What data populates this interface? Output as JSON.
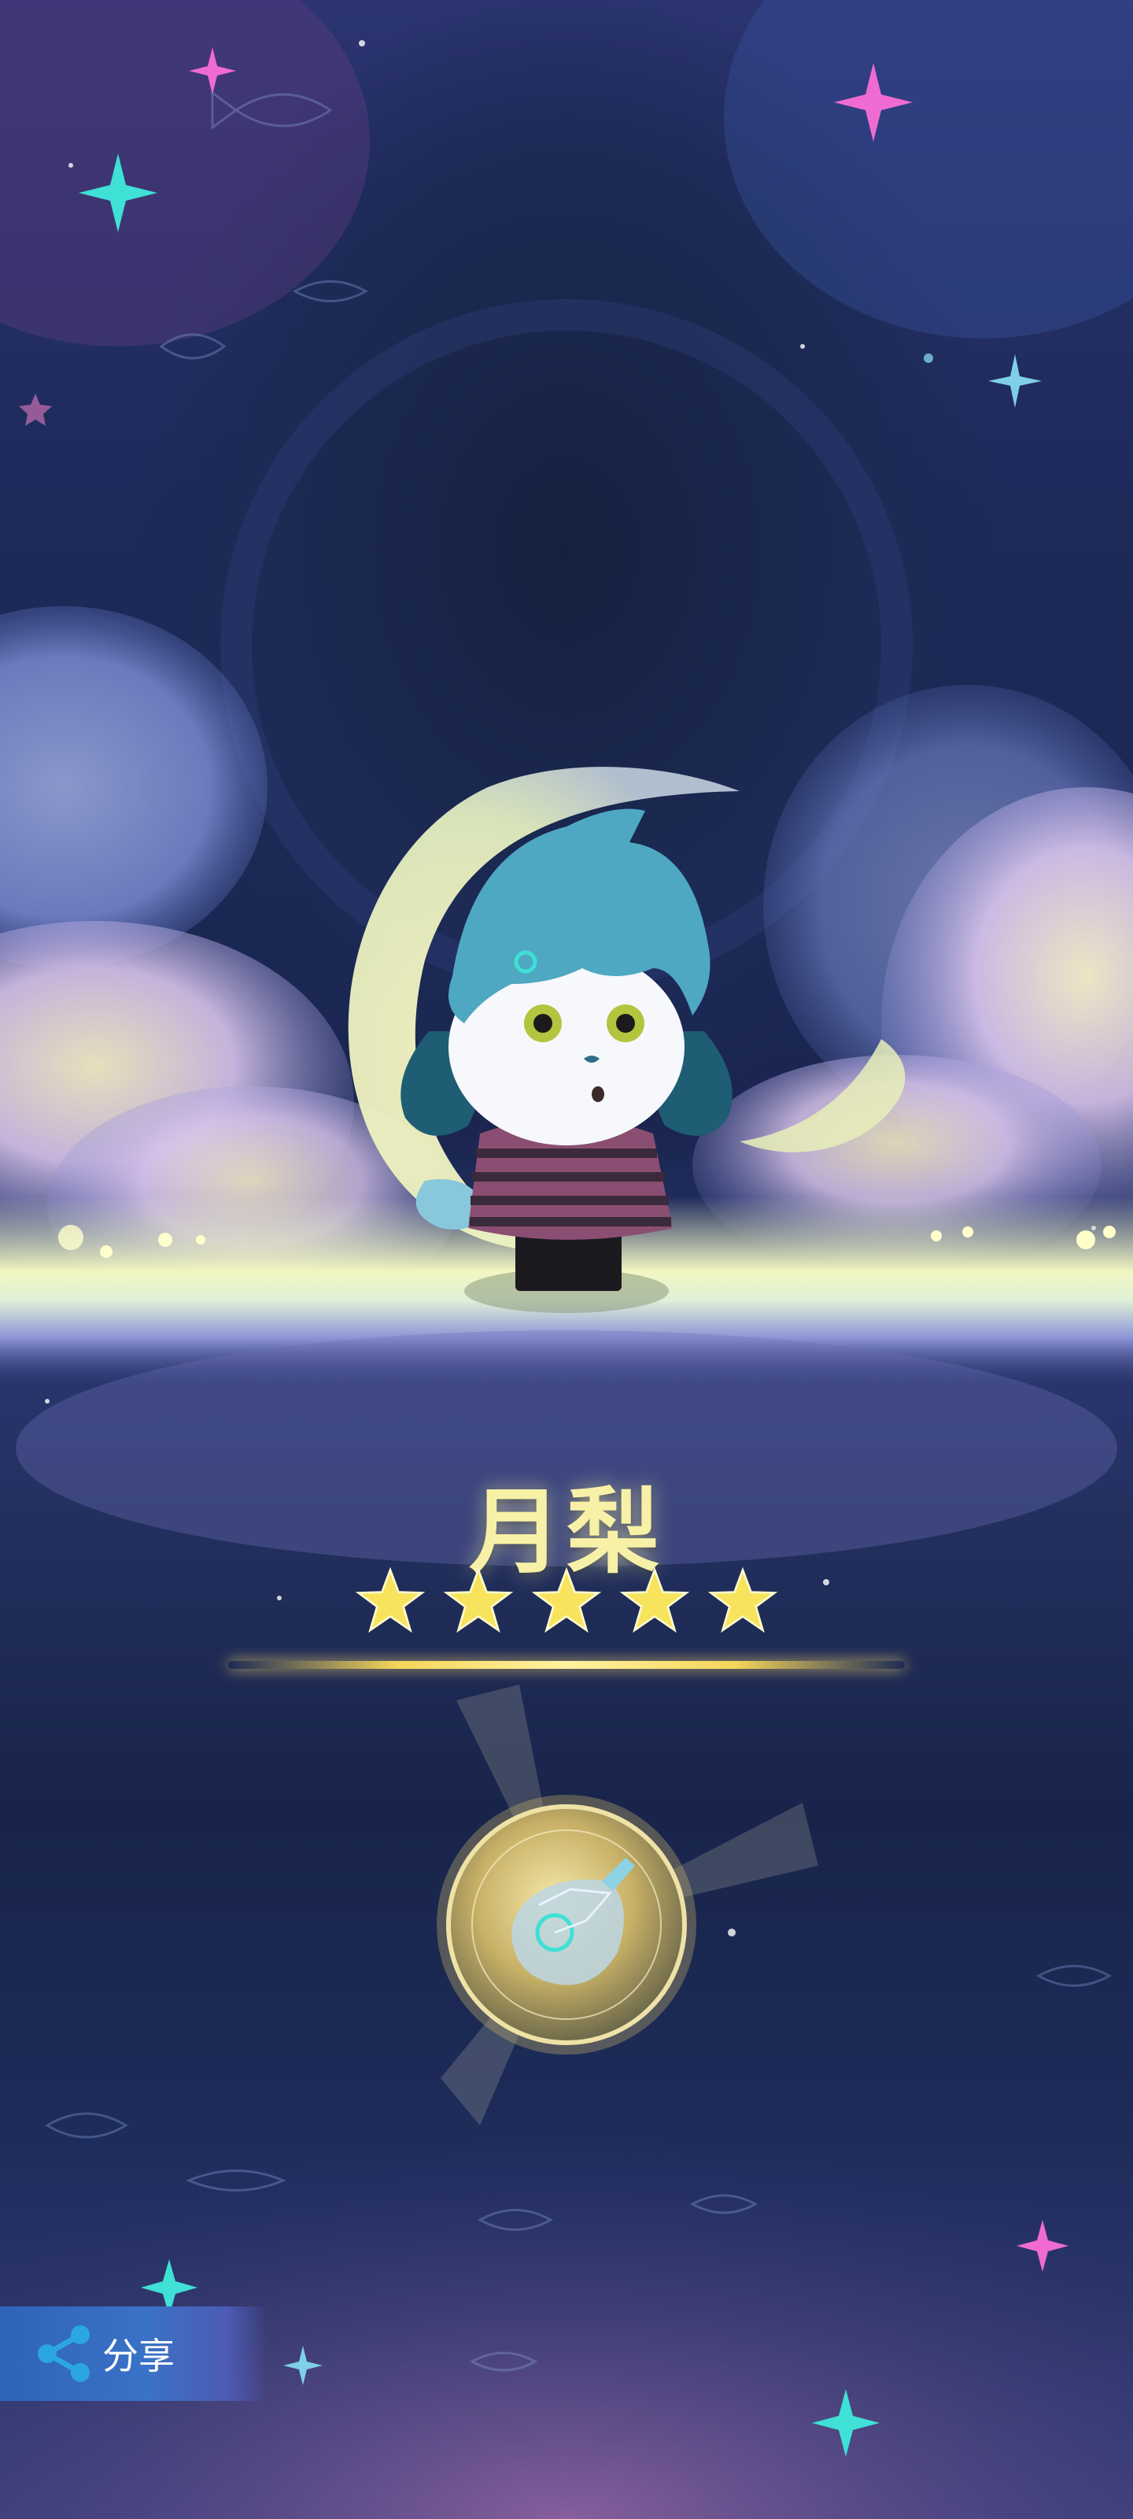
{
  "character": {
    "name": "月梨",
    "rarity_stars": 5
  },
  "reward_item": {
    "icon": "constellation-bottle-icon"
  },
  "share": {
    "label": "分享",
    "icon": "share-icon"
  },
  "colors": {
    "name_text": "#f6f1a6",
    "star_fill": "#f7e35c",
    "share_button": "#3a72c7",
    "background_top": "#2b3470",
    "horizon_glow": "#eef6c8"
  }
}
